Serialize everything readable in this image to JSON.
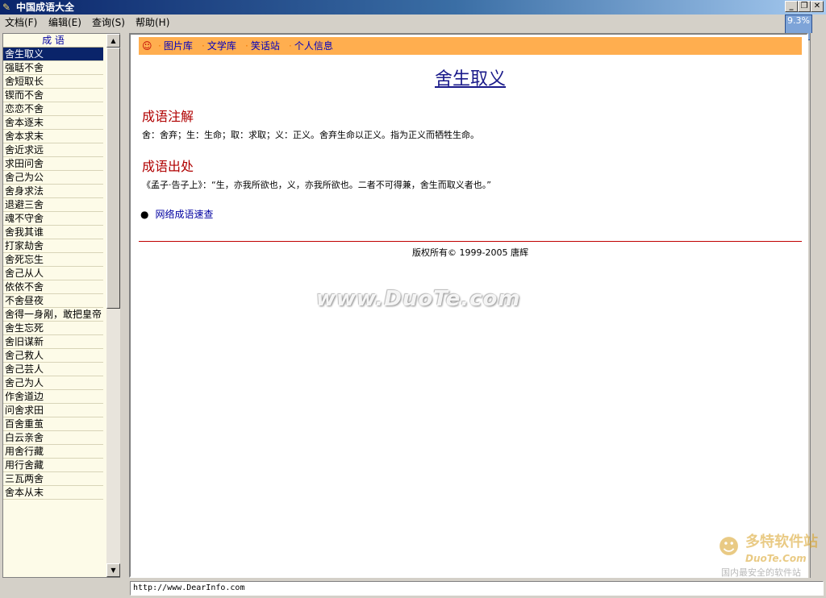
{
  "window": {
    "title": "中国成语大全",
    "cpu": "9.3%",
    "minimize_glyph": "_",
    "restore_glyph": "❐",
    "close_glyph": "✕"
  },
  "menu": [
    "文档(F)",
    "编辑(E)",
    "查询(S)",
    "帮助(H)"
  ],
  "idiom_list": {
    "header": "成 语",
    "items": [
      "舍生取义",
      "强聒不舍",
      "舍短取长",
      "锲而不舍",
      "恋恋不舍",
      "舍本逐末",
      "舍本求末",
      "舍近求远",
      "求田问舍",
      "舍己为公",
      "舍身求法",
      "退避三舍",
      "魂不守舍",
      "舍我其谁",
      "打家劫舍",
      "舍死忘生",
      "舍己从人",
      "依依不舍",
      "不舍昼夜",
      "舍得一身剐，敢把皇帝",
      "舍生忘死",
      "舍旧谋新",
      "舍己救人",
      "舍己芸人",
      "舍己为人",
      "作舍道边",
      "问舍求田",
      "百舍重茧",
      "白云亲舍",
      "用舍行藏",
      "用行舍藏",
      "三瓦两舍",
      "舍本从末"
    ],
    "selected_index": 0
  },
  "nav": {
    "links": [
      "图片库",
      "文学库",
      "笑话站",
      "个人信息"
    ]
  },
  "article": {
    "title": "舍生取义",
    "section1_title": "成语注解",
    "section1_text": "舍：舍弃；生：生命；取：求取；义：正义。舍弃生命以正义。指为正义而牺牲生命。",
    "section2_title": "成语出处",
    "section2_text": "《孟子·告子上》：“生，亦我所欲也，义，亦我所欲也。二者不可得兼，舍生而取义者也。”",
    "link_text": "网络成语速查",
    "copyright": "版权所有© 1999-2005 唐辉"
  },
  "status": {
    "url": "http://www.DearInfo.com"
  },
  "watermarks": {
    "center": "www.DuoTe.com",
    "logo_main": "多特软件站",
    "logo_url": "DuoTe.Com",
    "logo_sub": "国内最安全的软件站"
  }
}
